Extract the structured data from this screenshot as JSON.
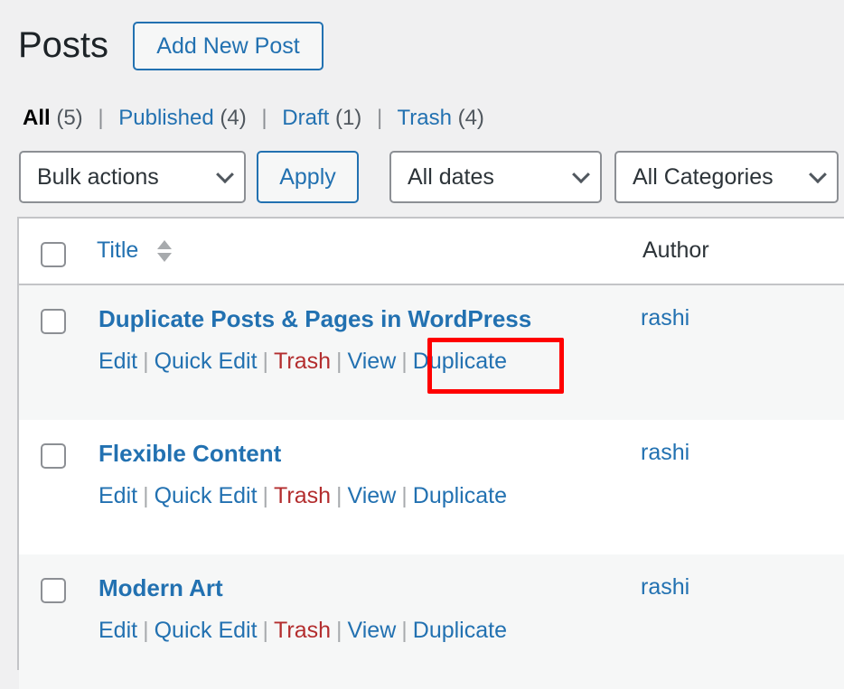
{
  "header": {
    "title": "Posts",
    "add_new_label": "Add New Post"
  },
  "filters_status": [
    {
      "label": "All",
      "count": "(5)",
      "current": true
    },
    {
      "label": "Published",
      "count": "(4)",
      "current": false
    },
    {
      "label": "Draft",
      "count": "(1)",
      "current": false
    },
    {
      "label": "Trash",
      "count": "(4)",
      "current": false
    }
  ],
  "toolbar": {
    "bulk_actions": "Bulk actions",
    "apply_label": "Apply",
    "dates": "All dates",
    "categories": "All Categories"
  },
  "table": {
    "columns": {
      "title": "Title",
      "author": "Author"
    },
    "rows": [
      {
        "title": "Duplicate Posts & Pages in WordPress",
        "author": "rashi",
        "actions": [
          "Edit",
          "Quick Edit",
          "Trash",
          "View",
          "Duplicate"
        ]
      },
      {
        "title": "Flexible Content",
        "author": "rashi",
        "actions": [
          "Edit",
          "Quick Edit",
          "Trash",
          "View",
          "Duplicate"
        ]
      },
      {
        "title": "Modern Art",
        "author": "rashi",
        "actions": [
          "Edit",
          "Quick Edit",
          "Trash",
          "View",
          "Duplicate"
        ]
      }
    ]
  },
  "annotation": {
    "highlight_color": "#ff0000",
    "highlighted_action": "Duplicate"
  },
  "colors": {
    "link": "#2271b1",
    "trash": "#b32d2e",
    "background": "#f0f0f1"
  }
}
